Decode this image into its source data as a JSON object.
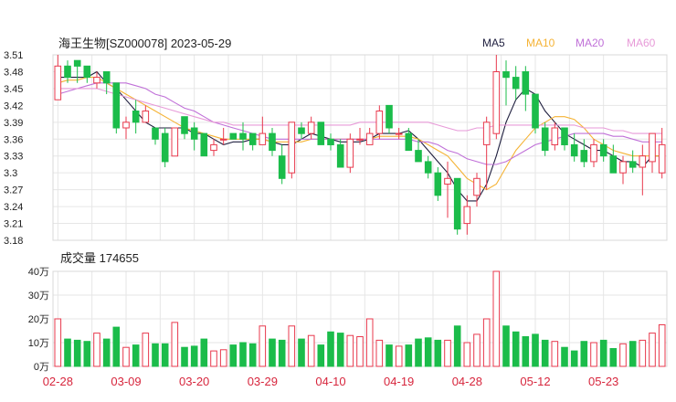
{
  "header": {
    "title": "海王生物[SZ000078] 2023-05-29"
  },
  "legend": [
    {
      "label": "MA5",
      "color": "#1f1f3f"
    },
    {
      "label": "MA10",
      "color": "#f5b335"
    },
    {
      "label": "MA20",
      "color": "#c070d8"
    },
    {
      "label": "MA60",
      "color": "#e79ad8"
    }
  ],
  "volume_header": {
    "label": "成交量 174655"
  },
  "colors": {
    "up": "#e8394d",
    "down": "#1bbc4a",
    "grid": "#e6e6e6",
    "axis_text": "#222222",
    "date_text": "#d7263d"
  },
  "chart_data": {
    "type": "candlestick",
    "price_axis": {
      "ticks": [
        "3.51",
        "3.48",
        "3.45",
        "3.42",
        "3.39",
        "3.36",
        "3.33",
        "3.3",
        "3.27",
        "3.24",
        "3.21",
        "3.18"
      ],
      "ylim": [
        3.18,
        3.51
      ]
    },
    "volume_axis": {
      "ticks": [
        "40万",
        "30万",
        "20万",
        "10万",
        "0万"
      ],
      "ylim": [
        0,
        40
      ]
    },
    "x_ticks": [
      {
        "label": "02-28",
        "index": 0
      },
      {
        "label": "03-09",
        "index": 7
      },
      {
        "label": "03-20",
        "index": 14
      },
      {
        "label": "03-29",
        "index": 21
      },
      {
        "label": "04-10",
        "index": 28
      },
      {
        "label": "04-19",
        "index": 35
      },
      {
        "label": "04-28",
        "index": 42
      },
      {
        "label": "05-12",
        "index": 49
      },
      {
        "label": "05-23",
        "index": 56
      }
    ],
    "candles": [
      [
        3.43,
        3.49,
        3.51,
        3.43,
        20
      ],
      [
        3.49,
        3.47,
        3.5,
        3.46,
        11.5
      ],
      [
        3.5,
        3.49,
        3.5,
        3.46,
        11
      ],
      [
        3.49,
        3.47,
        3.49,
        3.46,
        10.5
      ],
      [
        3.46,
        3.47,
        3.48,
        3.45,
        14
      ],
      [
        3.48,
        3.46,
        3.48,
        3.44,
        11.5
      ],
      [
        3.46,
        3.38,
        3.46,
        3.37,
        16.5
      ],
      [
        3.38,
        3.39,
        3.4,
        3.36,
        8
      ],
      [
        3.41,
        3.39,
        3.43,
        3.37,
        9
      ],
      [
        3.39,
        3.41,
        3.42,
        3.39,
        14
      ],
      [
        3.38,
        3.36,
        3.38,
        3.35,
        9.5
      ],
      [
        3.37,
        3.32,
        3.38,
        3.31,
        9.5
      ],
      [
        3.33,
        3.38,
        3.38,
        3.33,
        18.5
      ],
      [
        3.4,
        3.37,
        3.4,
        3.36,
        8
      ],
      [
        3.38,
        3.36,
        3.39,
        3.34,
        8.5
      ],
      [
        3.37,
        3.33,
        3.37,
        3.33,
        11.5
      ],
      [
        3.34,
        3.35,
        3.36,
        3.33,
        6.5
      ],
      [
        3.36,
        3.36,
        3.38,
        3.35,
        7
      ],
      [
        3.37,
        3.36,
        3.37,
        3.36,
        9
      ],
      [
        3.37,
        3.36,
        3.39,
        3.34,
        10
      ],
      [
        3.37,
        3.35,
        3.37,
        3.34,
        9.5
      ],
      [
        3.35,
        3.37,
        3.4,
        3.35,
        17
      ],
      [
        3.37,
        3.34,
        3.38,
        3.33,
        11.5
      ],
      [
        3.33,
        3.29,
        3.35,
        3.28,
        11
      ],
      [
        3.3,
        3.39,
        3.39,
        3.29,
        17
      ],
      [
        3.38,
        3.37,
        3.39,
        3.36,
        11.5
      ],
      [
        3.37,
        3.39,
        3.4,
        3.36,
        13
      ],
      [
        3.39,
        3.35,
        3.39,
        3.35,
        9
      ],
      [
        3.36,
        3.35,
        3.37,
        3.34,
        14.5
      ],
      [
        3.35,
        3.31,
        3.36,
        3.31,
        14
      ],
      [
        3.31,
        3.36,
        3.37,
        3.3,
        13
      ],
      [
        3.36,
        3.36,
        3.38,
        3.35,
        12.5
      ],
      [
        3.35,
        3.37,
        3.38,
        3.35,
        20
      ],
      [
        3.37,
        3.41,
        3.42,
        3.36,
        11
      ],
      [
        3.42,
        3.38,
        3.42,
        3.37,
        9
      ],
      [
        3.37,
        3.37,
        3.38,
        3.36,
        8.5
      ],
      [
        3.37,
        3.34,
        3.38,
        3.34,
        9
      ],
      [
        3.34,
        3.32,
        3.36,
        3.32,
        11.5
      ],
      [
        3.32,
        3.3,
        3.33,
        3.29,
        12
      ],
      [
        3.3,
        3.26,
        3.31,
        3.25,
        11
      ],
      [
        3.28,
        3.29,
        3.32,
        3.22,
        11
      ],
      [
        3.29,
        3.2,
        3.29,
        3.19,
        17
      ],
      [
        3.21,
        3.24,
        3.26,
        3.19,
        10
      ],
      [
        3.26,
        3.29,
        3.3,
        3.24,
        13.5
      ],
      [
        3.35,
        3.39,
        3.4,
        3.27,
        20
      ],
      [
        3.37,
        3.48,
        3.51,
        3.36,
        40
      ],
      [
        3.48,
        3.47,
        3.5,
        3.42,
        17
      ],
      [
        3.47,
        3.45,
        3.49,
        3.43,
        14.5
      ],
      [
        3.48,
        3.44,
        3.49,
        3.41,
        12.5
      ],
      [
        3.44,
        3.38,
        3.44,
        3.37,
        13.5
      ],
      [
        3.38,
        3.34,
        3.39,
        3.33,
        11
      ],
      [
        3.35,
        3.38,
        3.39,
        3.34,
        10.5
      ],
      [
        3.38,
        3.35,
        3.38,
        3.34,
        8
      ],
      [
        3.35,
        3.33,
        3.37,
        3.32,
        6.5
      ],
      [
        3.34,
        3.32,
        3.36,
        3.31,
        10.5
      ],
      [
        3.32,
        3.35,
        3.36,
        3.31,
        10
      ],
      [
        3.35,
        3.33,
        3.36,
        3.32,
        11
      ],
      [
        3.33,
        3.3,
        3.35,
        3.3,
        7.5
      ],
      [
        3.3,
        3.32,
        3.33,
        3.28,
        9.5
      ],
      [
        3.32,
        3.31,
        3.34,
        3.3,
        10.5
      ],
      [
        3.31,
        3.33,
        3.35,
        3.26,
        11
      ],
      [
        3.32,
        3.37,
        3.37,
        3.3,
        14
      ],
      [
        3.3,
        3.35,
        3.38,
        3.29,
        17.5
      ]
    ],
    "ma_paths": {
      "MA5": [
        3.47,
        3.47,
        3.47,
        3.47,
        3.48,
        3.46,
        3.45,
        3.43,
        3.41,
        3.39,
        3.38,
        3.38,
        3.38,
        3.38,
        3.37,
        3.37,
        3.36,
        3.35,
        3.355,
        3.355,
        3.36,
        3.36,
        3.355,
        3.35,
        3.35,
        3.36,
        3.37,
        3.365,
        3.36,
        3.355,
        3.355,
        3.355,
        3.36,
        3.37,
        3.37,
        3.37,
        3.375,
        3.36,
        3.34,
        3.32,
        3.3,
        3.27,
        3.25,
        3.25,
        3.28,
        3.33,
        3.39,
        3.43,
        3.45,
        3.44,
        3.41,
        3.39,
        3.37,
        3.36,
        3.35,
        3.34,
        3.34,
        3.33,
        3.32,
        3.32,
        3.31,
        3.33,
        3.33
      ],
      "MA10": [
        3.46,
        3.465,
        3.465,
        3.47,
        3.47,
        3.46,
        3.45,
        3.44,
        3.43,
        3.42,
        3.41,
        3.4,
        3.39,
        3.38,
        3.375,
        3.37,
        3.365,
        3.36,
        3.36,
        3.36,
        3.36,
        3.36,
        3.355,
        3.355,
        3.355,
        3.355,
        3.36,
        3.36,
        3.36,
        3.36,
        3.36,
        3.36,
        3.36,
        3.365,
        3.365,
        3.365,
        3.365,
        3.36,
        3.35,
        3.34,
        3.33,
        3.31,
        3.29,
        3.28,
        3.27,
        3.28,
        3.31,
        3.34,
        3.36,
        3.38,
        3.39,
        3.4,
        3.4,
        3.395,
        3.38,
        3.36,
        3.35,
        3.34,
        3.335,
        3.33,
        3.33,
        3.33,
        3.33
      ],
      "MA20": [
        3.44,
        3.445,
        3.45,
        3.455,
        3.46,
        3.46,
        3.46,
        3.46,
        3.455,
        3.45,
        3.44,
        3.435,
        3.425,
        3.415,
        3.41,
        3.4,
        3.39,
        3.385,
        3.38,
        3.375,
        3.37,
        3.365,
        3.36,
        3.36,
        3.36,
        3.36,
        3.36,
        3.36,
        3.36,
        3.36,
        3.36,
        3.36,
        3.36,
        3.36,
        3.36,
        3.36,
        3.36,
        3.355,
        3.355,
        3.35,
        3.34,
        3.335,
        3.325,
        3.32,
        3.315,
        3.315,
        3.32,
        3.33,
        3.34,
        3.35,
        3.355,
        3.36,
        3.365,
        3.37,
        3.37,
        3.37,
        3.37,
        3.365,
        3.365,
        3.36,
        3.355,
        3.355,
        3.355
      ],
      "MA60": [
        3.45,
        3.45,
        3.45,
        3.45,
        3.45,
        3.445,
        3.44,
        3.435,
        3.43,
        3.425,
        3.42,
        3.415,
        3.41,
        3.405,
        3.4,
        3.395,
        3.39,
        3.39,
        3.385,
        3.385,
        3.385,
        3.385,
        3.385,
        3.385,
        3.385,
        3.385,
        3.385,
        3.385,
        3.385,
        3.385,
        3.385,
        3.39,
        3.39,
        3.39,
        3.39,
        3.39,
        3.39,
        3.39,
        3.39,
        3.385,
        3.38,
        3.375,
        3.375,
        3.38,
        3.38,
        3.385,
        3.385,
        3.385,
        3.385,
        3.385,
        3.385,
        3.385,
        3.385,
        3.385,
        3.38,
        3.38,
        3.38,
        3.375,
        3.375,
        3.37,
        3.37,
        3.37,
        3.37
      ]
    }
  }
}
